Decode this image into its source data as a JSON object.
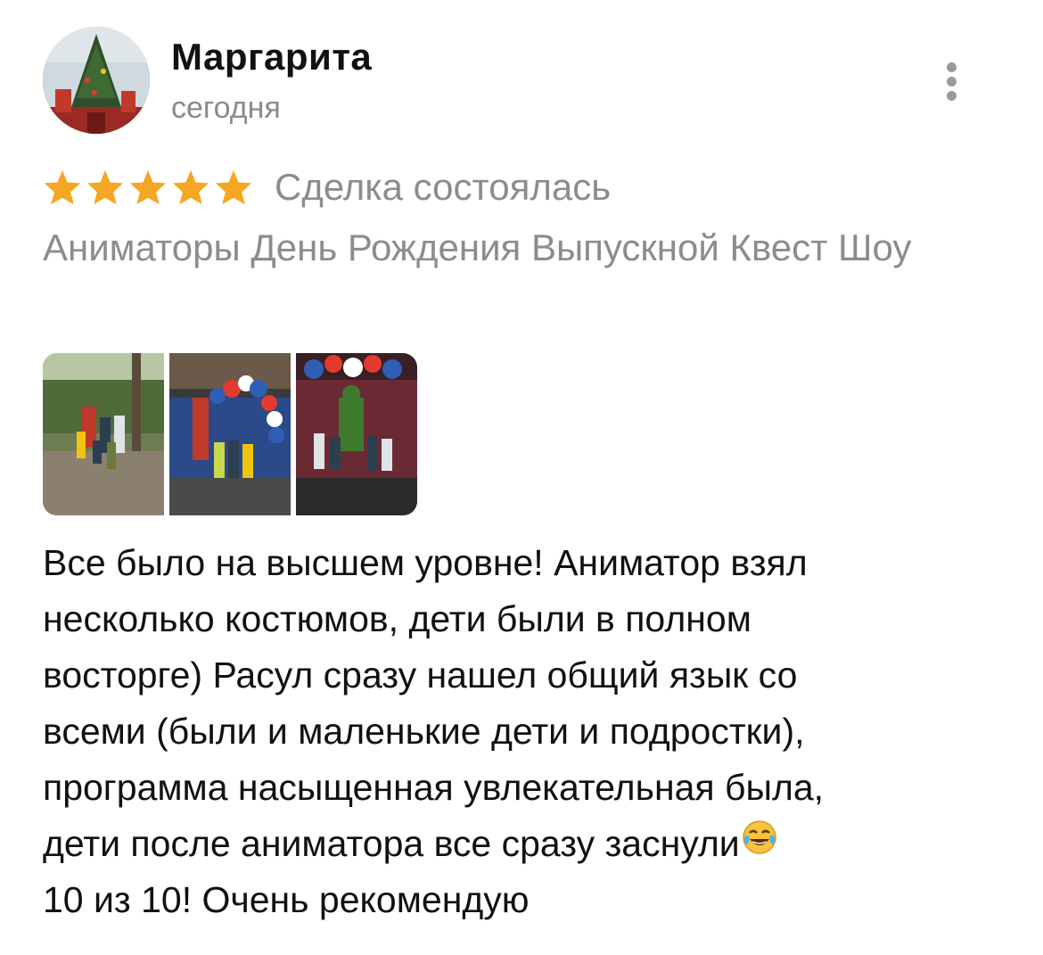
{
  "author": {
    "name": "Маргарита",
    "date": "сегодня",
    "avatar_icon": "christmas-tree-avatar"
  },
  "menu_icon": "more-vertical-icon",
  "rating": {
    "stars": 5,
    "max": 5,
    "star_color": "#F5A623",
    "status": "Сделка состоялась"
  },
  "service": {
    "title": "Аниматоры День Рождения Выпускной Квест Шоу"
  },
  "photos": [
    {
      "icon": "photo-park-spiderman"
    },
    {
      "icon": "photo-balloons-party"
    },
    {
      "icon": "photo-hulk-party"
    }
  ],
  "review": {
    "lines": [
      "Все было на высшем уровне! Аниматор взял",
      "несколько костюмов, дети были в полном",
      "восторге) Расул сразу нашел общий язык со",
      "всеми (были и маленькие дети и подростки),",
      "программа насыщенная увлекательная была,",
      "дети после аниматора все сразу заснули",
      "10 из 10! Очень рекомендую"
    ],
    "emoji_icon": "tears-of-joy-emoji"
  }
}
